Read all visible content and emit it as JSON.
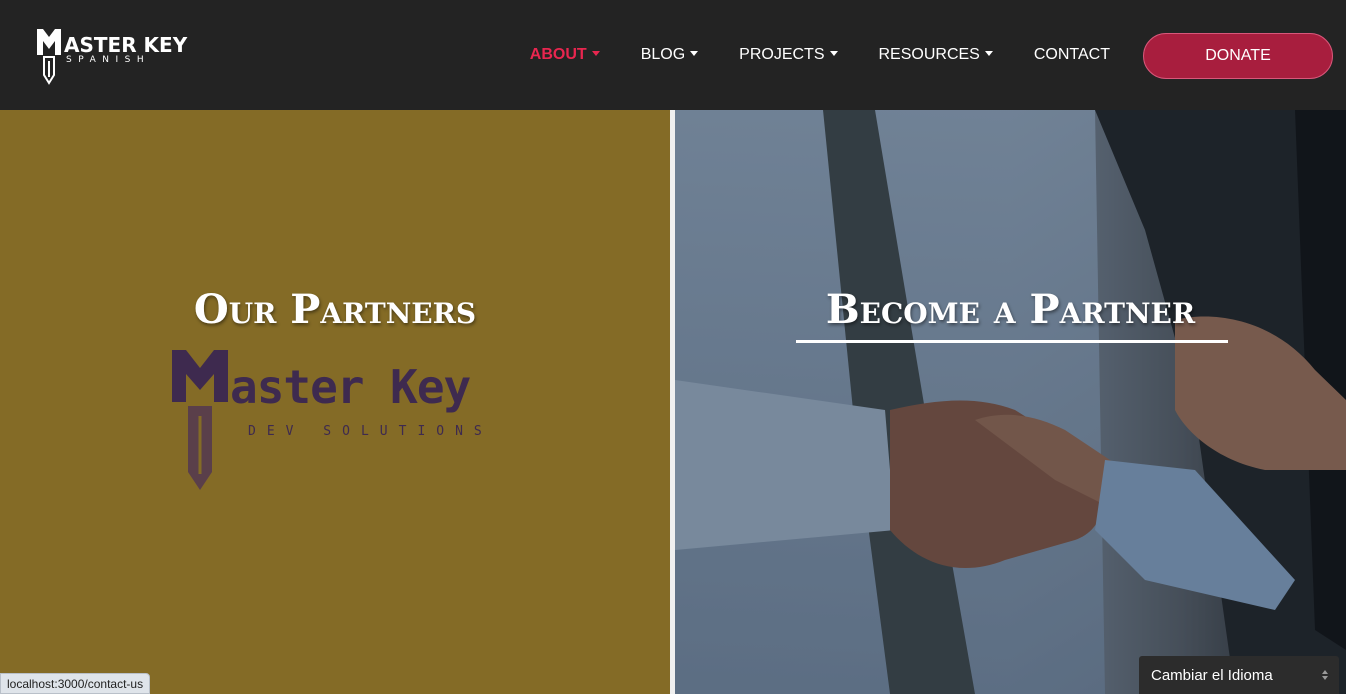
{
  "brand": {
    "name": "ASTER KEY",
    "subtitle": "SPANISH"
  },
  "nav": {
    "items": [
      {
        "label": "ABOUT",
        "has_dropdown": true,
        "active": true
      },
      {
        "label": "BLOG",
        "has_dropdown": true,
        "active": false
      },
      {
        "label": "PROJECTS",
        "has_dropdown": true,
        "active": false
      },
      {
        "label": "RESOURCES",
        "has_dropdown": true,
        "active": false
      },
      {
        "label": "CONTACT",
        "has_dropdown": false,
        "active": false
      }
    ],
    "donate_label": "DONATE"
  },
  "left_panel": {
    "title": "Our Partners",
    "partner": {
      "name": "aster Key",
      "subtitle": "DEV SOLUTIONS"
    },
    "background": "#846b26"
  },
  "right_panel": {
    "title": "Become a Partner"
  },
  "status_bar": {
    "url": "localhost:3000/contact-us"
  },
  "language_selector": {
    "label": "Cambiar el Idioma"
  },
  "colors": {
    "accent": "#e8264f",
    "donate": "#a81e3e",
    "navbar": "#232323"
  }
}
